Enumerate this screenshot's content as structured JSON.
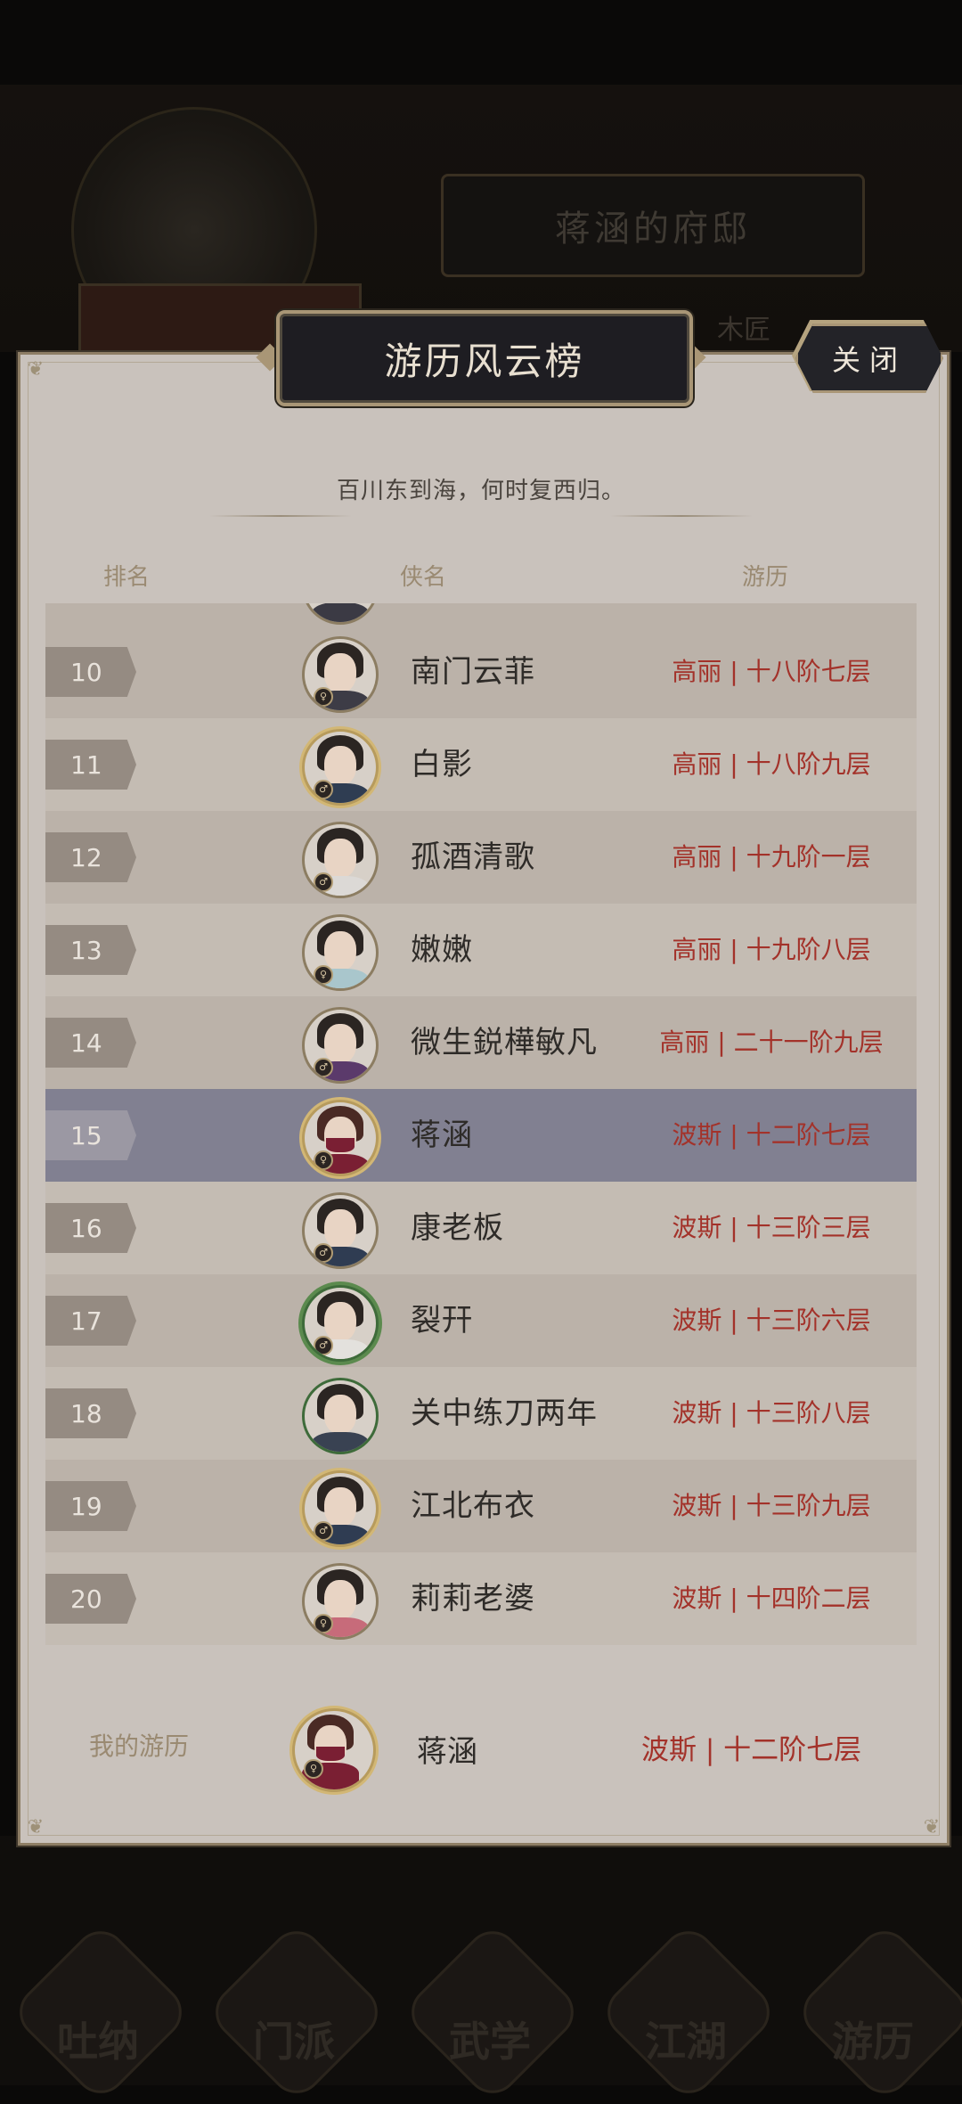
{
  "background": {
    "mansion_title": "蒋涵的府邸",
    "side_text_left": "...",
    "side_text_right": "木匠",
    "nav": [
      {
        "label": "吐纳",
        "icon": "breath-icon"
      },
      {
        "label": "门派",
        "icon": "sect-icon"
      },
      {
        "label": "武学",
        "icon": "martial-arts-icon"
      },
      {
        "label": "江湖",
        "icon": "jianghu-icon"
      },
      {
        "label": "游历",
        "icon": "travel-icon"
      }
    ]
  },
  "panel": {
    "title": "游历风云榜",
    "close_label": "关闭",
    "subtitle": "百川东到海，何时复西归。",
    "headers": {
      "rank": "排名",
      "name": "侠名",
      "trip": "游历"
    }
  },
  "rows": [
    {
      "rank": "10",
      "name": "南门云菲",
      "trip": "高丽 | 十八阶七层"
    },
    {
      "rank": "11",
      "name": "白影",
      "trip": "高丽 | 十八阶九层"
    },
    {
      "rank": "12",
      "name": "孤酒清歌",
      "trip": "高丽 | 十九阶一层"
    },
    {
      "rank": "13",
      "name": "嫩嫩",
      "trip": "高丽 | 十九阶八层"
    },
    {
      "rank": "14",
      "name": "微生鋭樺敏凡",
      "trip": "高丽 | 二十一阶九层"
    },
    {
      "rank": "15",
      "name": "蒋涵",
      "trip": "波斯 | 十二阶七层"
    },
    {
      "rank": "16",
      "name": "康老板",
      "trip": "波斯 | 十三阶三层"
    },
    {
      "rank": "17",
      "name": "裂幵",
      "trip": "波斯 | 十三阶六层"
    },
    {
      "rank": "18",
      "name": "关中练刀两年",
      "trip": "波斯 | 十三阶八层"
    },
    {
      "rank": "19",
      "name": "江北布衣",
      "trip": "波斯 | 十三阶九层"
    },
    {
      "rank": "20",
      "name": "莉莉老婆",
      "trip": "波斯 | 十四阶二层"
    }
  ],
  "mine": {
    "label": "我的游历",
    "name": "蒋涵",
    "trip": "波斯 | 十二阶七层"
  },
  "colors": {
    "panel_bg": "#c9c2bc",
    "row_odd": "#bbb2a9",
    "row_even": "#c4bcb3",
    "highlight_row": "#818091",
    "trip_text": "#a3322a",
    "title_plate": "#1e1d22"
  }
}
